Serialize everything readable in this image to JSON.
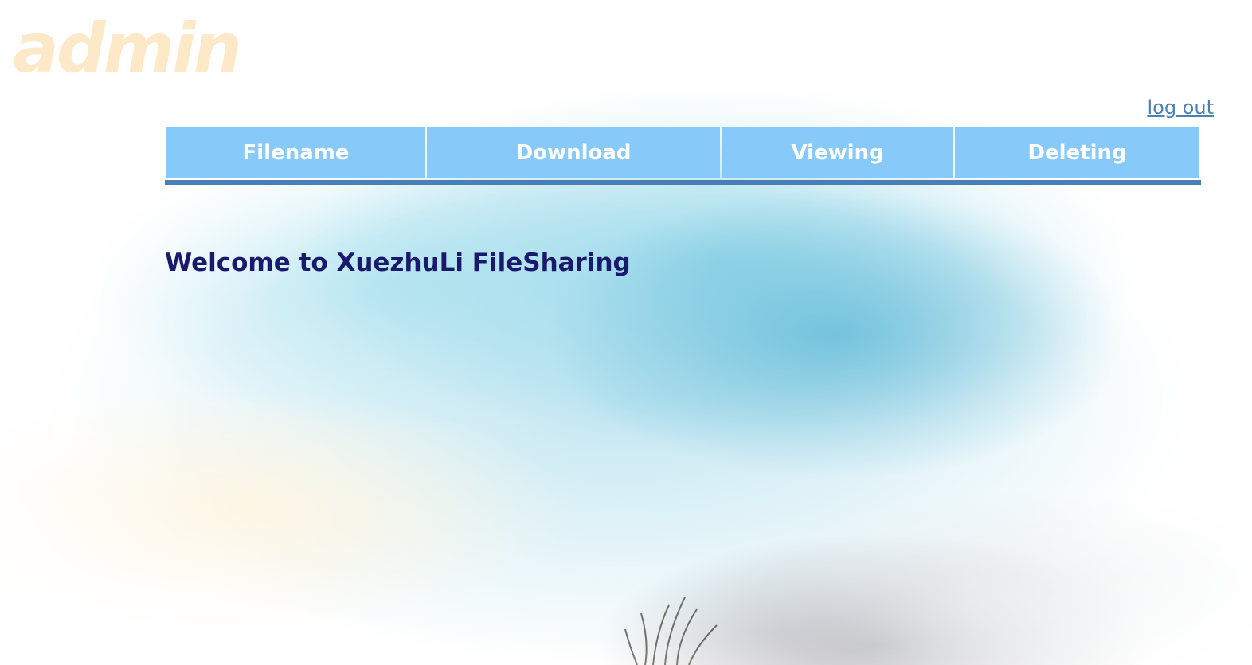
{
  "user": {
    "name": "admin"
  },
  "nav": {
    "logout_label": "log out"
  },
  "table": {
    "headers": [
      "Filename",
      "Download",
      "Viewing",
      "Deleting"
    ]
  },
  "main": {
    "welcome_text": "Welcome to XuezhuLi FileSharing"
  },
  "colors": {
    "header_bg": "#87cafa",
    "header_border": "#4a7fb5",
    "welcome_text": "#1a1a6c",
    "logo_text": "#fde8c8",
    "link": "#4a82b6"
  }
}
